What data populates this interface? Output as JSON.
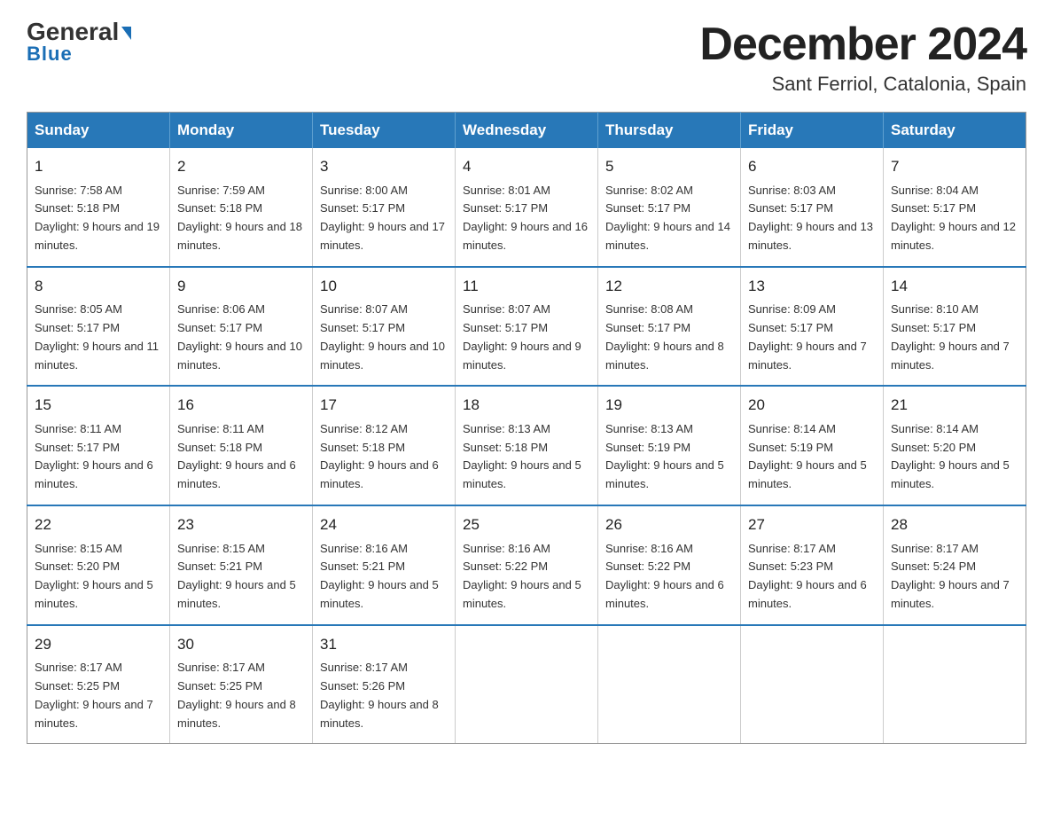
{
  "header": {
    "logo_line1": "General",
    "logo_line2": "Blue",
    "month_title": "December 2024",
    "location": "Sant Ferriol, Catalonia, Spain"
  },
  "days_of_week": [
    "Sunday",
    "Monday",
    "Tuesday",
    "Wednesday",
    "Thursday",
    "Friday",
    "Saturday"
  ],
  "weeks": [
    [
      {
        "day": "1",
        "sunrise": "7:58 AM",
        "sunset": "5:18 PM",
        "daylight": "9 hours and 19 minutes."
      },
      {
        "day": "2",
        "sunrise": "7:59 AM",
        "sunset": "5:18 PM",
        "daylight": "9 hours and 18 minutes."
      },
      {
        "day": "3",
        "sunrise": "8:00 AM",
        "sunset": "5:17 PM",
        "daylight": "9 hours and 17 minutes."
      },
      {
        "day": "4",
        "sunrise": "8:01 AM",
        "sunset": "5:17 PM",
        "daylight": "9 hours and 16 minutes."
      },
      {
        "day": "5",
        "sunrise": "8:02 AM",
        "sunset": "5:17 PM",
        "daylight": "9 hours and 14 minutes."
      },
      {
        "day": "6",
        "sunrise": "8:03 AM",
        "sunset": "5:17 PM",
        "daylight": "9 hours and 13 minutes."
      },
      {
        "day": "7",
        "sunrise": "8:04 AM",
        "sunset": "5:17 PM",
        "daylight": "9 hours and 12 minutes."
      }
    ],
    [
      {
        "day": "8",
        "sunrise": "8:05 AM",
        "sunset": "5:17 PM",
        "daylight": "9 hours and 11 minutes."
      },
      {
        "day": "9",
        "sunrise": "8:06 AM",
        "sunset": "5:17 PM",
        "daylight": "9 hours and 10 minutes."
      },
      {
        "day": "10",
        "sunrise": "8:07 AM",
        "sunset": "5:17 PM",
        "daylight": "9 hours and 10 minutes."
      },
      {
        "day": "11",
        "sunrise": "8:07 AM",
        "sunset": "5:17 PM",
        "daylight": "9 hours and 9 minutes."
      },
      {
        "day": "12",
        "sunrise": "8:08 AM",
        "sunset": "5:17 PM",
        "daylight": "9 hours and 8 minutes."
      },
      {
        "day": "13",
        "sunrise": "8:09 AM",
        "sunset": "5:17 PM",
        "daylight": "9 hours and 7 minutes."
      },
      {
        "day": "14",
        "sunrise": "8:10 AM",
        "sunset": "5:17 PM",
        "daylight": "9 hours and 7 minutes."
      }
    ],
    [
      {
        "day": "15",
        "sunrise": "8:11 AM",
        "sunset": "5:17 PM",
        "daylight": "9 hours and 6 minutes."
      },
      {
        "day": "16",
        "sunrise": "8:11 AM",
        "sunset": "5:18 PM",
        "daylight": "9 hours and 6 minutes."
      },
      {
        "day": "17",
        "sunrise": "8:12 AM",
        "sunset": "5:18 PM",
        "daylight": "9 hours and 6 minutes."
      },
      {
        "day": "18",
        "sunrise": "8:13 AM",
        "sunset": "5:18 PM",
        "daylight": "9 hours and 5 minutes."
      },
      {
        "day": "19",
        "sunrise": "8:13 AM",
        "sunset": "5:19 PM",
        "daylight": "9 hours and 5 minutes."
      },
      {
        "day": "20",
        "sunrise": "8:14 AM",
        "sunset": "5:19 PM",
        "daylight": "9 hours and 5 minutes."
      },
      {
        "day": "21",
        "sunrise": "8:14 AM",
        "sunset": "5:20 PM",
        "daylight": "9 hours and 5 minutes."
      }
    ],
    [
      {
        "day": "22",
        "sunrise": "8:15 AM",
        "sunset": "5:20 PM",
        "daylight": "9 hours and 5 minutes."
      },
      {
        "day": "23",
        "sunrise": "8:15 AM",
        "sunset": "5:21 PM",
        "daylight": "9 hours and 5 minutes."
      },
      {
        "day": "24",
        "sunrise": "8:16 AM",
        "sunset": "5:21 PM",
        "daylight": "9 hours and 5 minutes."
      },
      {
        "day": "25",
        "sunrise": "8:16 AM",
        "sunset": "5:22 PM",
        "daylight": "9 hours and 5 minutes."
      },
      {
        "day": "26",
        "sunrise": "8:16 AM",
        "sunset": "5:22 PM",
        "daylight": "9 hours and 6 minutes."
      },
      {
        "day": "27",
        "sunrise": "8:17 AM",
        "sunset": "5:23 PM",
        "daylight": "9 hours and 6 minutes."
      },
      {
        "day": "28",
        "sunrise": "8:17 AM",
        "sunset": "5:24 PM",
        "daylight": "9 hours and 7 minutes."
      }
    ],
    [
      {
        "day": "29",
        "sunrise": "8:17 AM",
        "sunset": "5:25 PM",
        "daylight": "9 hours and 7 minutes."
      },
      {
        "day": "30",
        "sunrise": "8:17 AM",
        "sunset": "5:25 PM",
        "daylight": "9 hours and 8 minutes."
      },
      {
        "day": "31",
        "sunrise": "8:17 AM",
        "sunset": "5:26 PM",
        "daylight": "9 hours and 8 minutes."
      },
      null,
      null,
      null,
      null
    ]
  ]
}
